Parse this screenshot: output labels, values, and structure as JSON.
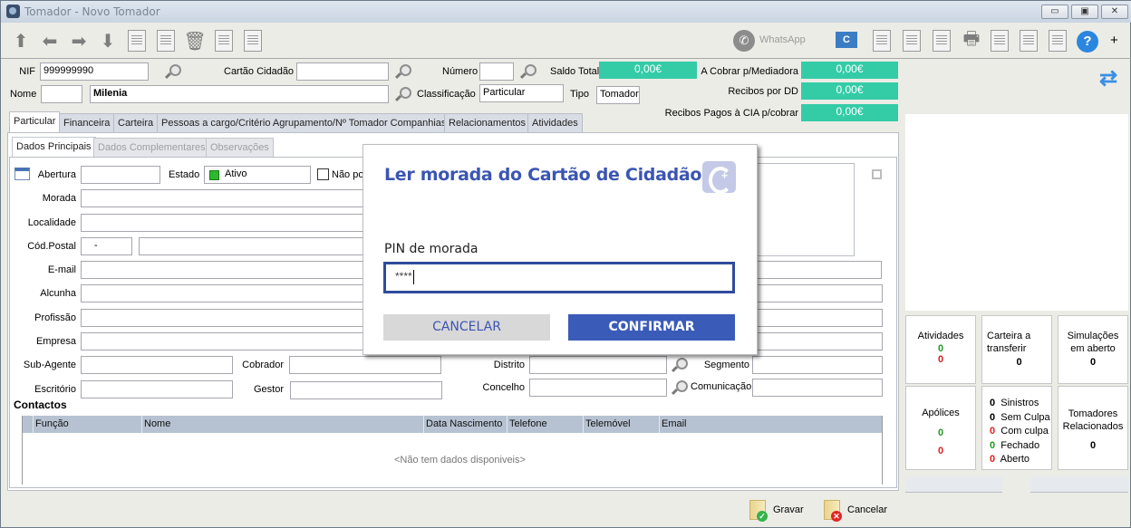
{
  "window": {
    "title": "Tomador - Novo Tomador",
    "controls": [
      "minimize",
      "restore",
      "close"
    ]
  },
  "toolbar": {
    "left_icons": [
      "arrow-up-icon",
      "arrow-left-icon",
      "arrow-right-icon",
      "arrow-down-icon",
      "new-document-icon",
      "edit-document-icon",
      "trash-icon",
      "view-document-icon",
      "list-document-icon"
    ],
    "whatsapp_label": "WhatsApp",
    "right_icons": [
      "citizen-card-icon",
      "calendar-document-icon",
      "email-document-icon",
      "scanner-icon",
      "printer-icon",
      "word-export-icon",
      "copy-document-icon",
      "user-document-icon",
      "help-icon",
      "plus-icon"
    ],
    "plus_label": "+",
    "help_label": "?"
  },
  "header": {
    "nif_label": "NIF",
    "nif_value": "999999990",
    "cartao_label": "Cartão Cidadão",
    "cartao_value": "",
    "numero_label": "Número",
    "numero_value": "",
    "saldo_label": "Saldo Total",
    "saldo_value": "0,00€",
    "cobrar_label": "A Cobrar p/Mediadora",
    "cobrar_value": "0,00€",
    "nome_label": "Nome",
    "nome_prefix": "",
    "nome_value": "Milenia",
    "classificacao_label": "Classificação",
    "classificacao_value": "Particular",
    "tipo_label": "Tipo",
    "tipo_value": "Tomador",
    "recibos_dd_label": "Recibos por DD",
    "recibos_dd_value": "0,00€",
    "recibos_pagos_label": "Recibos Pagos à CIA p/cobrar",
    "recibos_pagos_value": "0,00€"
  },
  "tabs": [
    {
      "label": "Particular",
      "active": true
    },
    {
      "label": "Financeira"
    },
    {
      "label": "Carteira"
    },
    {
      "label": "Pessoas a cargo/Critério Agrupamento/Nº Tomador Companhias"
    },
    {
      "label": "Relacionamentos"
    },
    {
      "label": "Atividades"
    }
  ],
  "subtabs": [
    {
      "label": "Dados Principais",
      "active": true
    },
    {
      "label": "Dados Complementares"
    },
    {
      "label": "Observações"
    }
  ],
  "form": {
    "abertura_label": "Abertura",
    "abertura_value": "",
    "estado_label": "Estado",
    "estado_value": "Ativo",
    "estado_color": "#2db82d",
    "nao_label": "Não po",
    "morada_label": "Morada",
    "localidade_label": "Localidade",
    "codpostal_label": "Cód.Postal",
    "codpostal_value": "-",
    "email_label": "E-mail",
    "alcunha_label": "Alcunha",
    "profissao_label": "Profissão",
    "empresa_label": "Empresa",
    "subagente_label": "Sub-Agente",
    "cobrador_label": "Cobrador",
    "distrito_label": "Distrito",
    "segmento_label": "Segmento",
    "escritorio_label": "Escritório",
    "gestor_label": "Gestor",
    "concelho_label": "Concelho",
    "comunicacao_label": "Comunicação"
  },
  "contactos": {
    "title": "Contactos",
    "columns": [
      "Função",
      "Nome",
      "Data Nascimento",
      "Telefone",
      "Telemóvel",
      "Email"
    ],
    "empty_text": "<Não tem dados disponiveis>"
  },
  "side_cards": {
    "atividades": {
      "label": "Atividades",
      "green": "0",
      "red": "0"
    },
    "carteira": {
      "label": "Carteira a transferir",
      "value": "0"
    },
    "simulacoes": {
      "label": "Simulações em aberto",
      "value": "0"
    },
    "apolices": {
      "label": "Apólices",
      "green": "0",
      "red": "0"
    },
    "sinistros": [
      {
        "count": "0",
        "label": "Sinistros",
        "color": "black"
      },
      {
        "count": "0",
        "label": "Sem Culpa",
        "color": "black"
      },
      {
        "count": "0",
        "label": "Com culpa",
        "color": "red"
      },
      {
        "count": "0",
        "label": "Fechado",
        "color": "green"
      },
      {
        "count": "0",
        "label": "Aberto",
        "color": "red"
      }
    ],
    "tomadores": {
      "label": "Tomadores Relacionados",
      "value": "0"
    }
  },
  "footer": {
    "gravar_label": "Gravar",
    "cancelar_label": "Cancelar"
  },
  "dialog": {
    "title": "Ler morada do Cartão de Cidadão",
    "pin_label": "PIN de morada",
    "pin_value": "****",
    "cancel_label": "CANCELAR",
    "confirm_label": "CONFIRMAR",
    "accent_color": "#3a5bb8"
  }
}
